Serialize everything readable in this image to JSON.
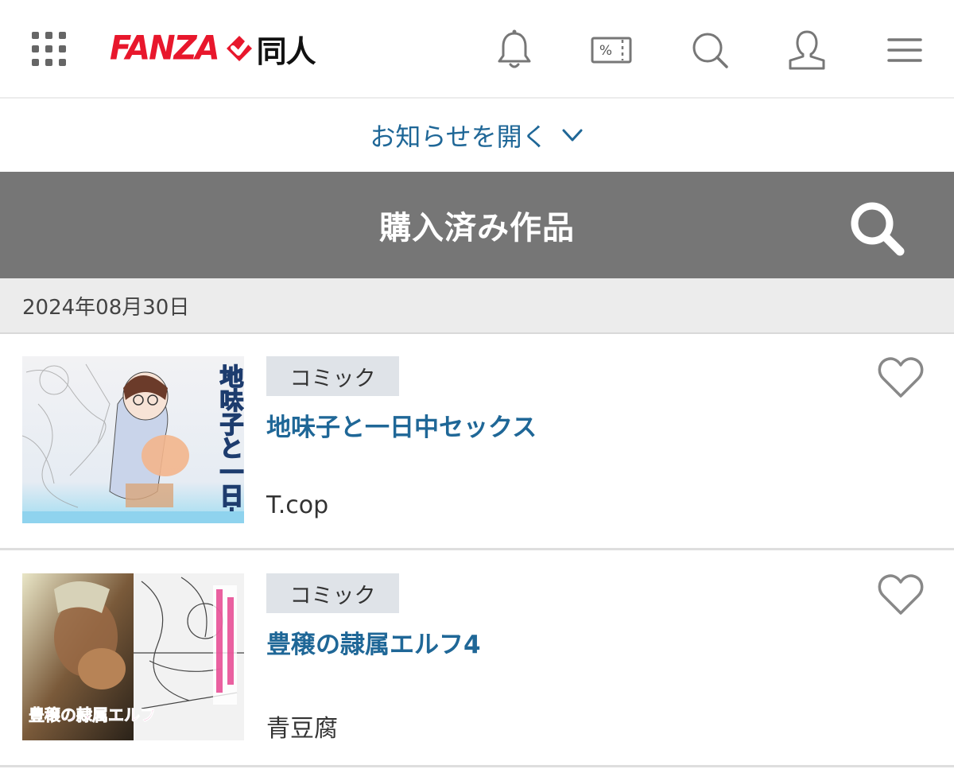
{
  "header": {
    "logo_text": "FANZA",
    "logo_sub": "同人",
    "icons": [
      "apps-grid-icon",
      "bell-icon",
      "coupon-icon",
      "search-icon",
      "user-icon",
      "menu-icon"
    ],
    "coupon_symbol": "%"
  },
  "notice": {
    "label": "お知らせを開く"
  },
  "page": {
    "title": "購入済み作品"
  },
  "date_group": {
    "date": "2024年08月30日"
  },
  "items": [
    {
      "category": "コミック",
      "title": "地味子と一日中セックス",
      "author": "T.cop",
      "thumb_text": "地味子と一日中セックス"
    },
    {
      "category": "コミック",
      "title": "豊穣の隷属エルフ4",
      "author": "青豆腐",
      "thumb_text": "豊穣の隷属エルフ"
    }
  ],
  "colors": {
    "brand_red": "#e8172c",
    "link_blue": "#1f6797",
    "title_bar": "#767676",
    "date_bar": "#ececec",
    "badge_bg": "#dfe3e8"
  }
}
